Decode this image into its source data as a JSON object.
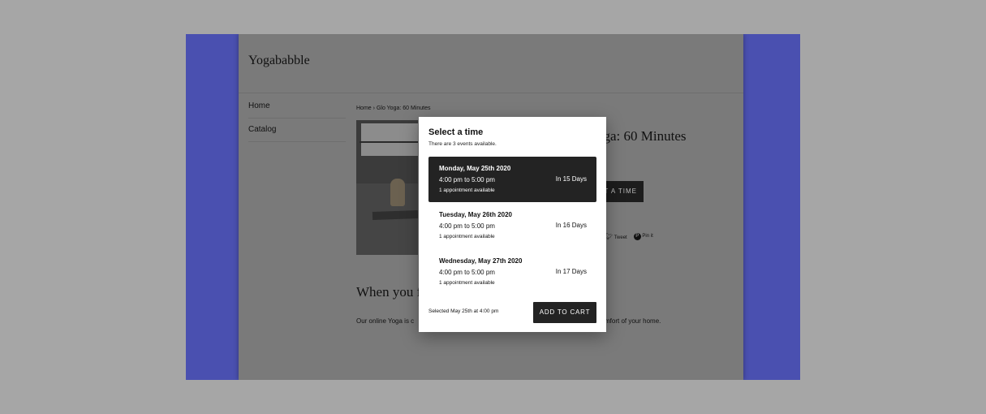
{
  "site": {
    "title": "Yogababble"
  },
  "nav": {
    "items": [
      {
        "label": "Home"
      },
      {
        "label": "Catalog"
      }
    ]
  },
  "breadcrumb": {
    "home": "Home",
    "separator": "›",
    "current": "Glo Yoga: 60 Minutes"
  },
  "product": {
    "title_visible": "oga: 60 Minutes",
    "select_time_label_visible": "T A TIME",
    "share": {
      "tweet": "Tweet",
      "pin": "Pin it"
    },
    "section_heading_visible": "When you f",
    "description_left_visible": "Our online Yoga is c",
    "description_right_visible": "mfort of your home."
  },
  "modal": {
    "title": "Select a time",
    "subtitle": "There are 3 events available.",
    "slots": [
      {
        "date": "Monday, May 25th 2020",
        "time": "4:00 pm to 5:00 pm",
        "availability": "1 appointment available",
        "relative": "In 15 Days",
        "selected": true
      },
      {
        "date": "Tuesday, May 26th 2020",
        "time": "4:00 pm to 5:00 pm",
        "availability": "1 appointment available",
        "relative": "In 16 Days",
        "selected": false
      },
      {
        "date": "Wednesday, May 27th 2020",
        "time": "4:00 pm to 5:00 pm",
        "availability": "1 appointment available",
        "relative": "In 17 Days",
        "selected": false
      }
    ],
    "selected_text": "Selected May 25th at 4:00 pm",
    "add_to_cart": "ADD TO CART"
  },
  "colors": {
    "frame": "#4a50b0",
    "overlay_page": "#7a7a7a",
    "backdrop": "#a6a6a6",
    "selected_slot": "#232323"
  },
  "icons": {
    "tweet": "twitter-bird-icon",
    "pin": "pinterest-icon"
  }
}
